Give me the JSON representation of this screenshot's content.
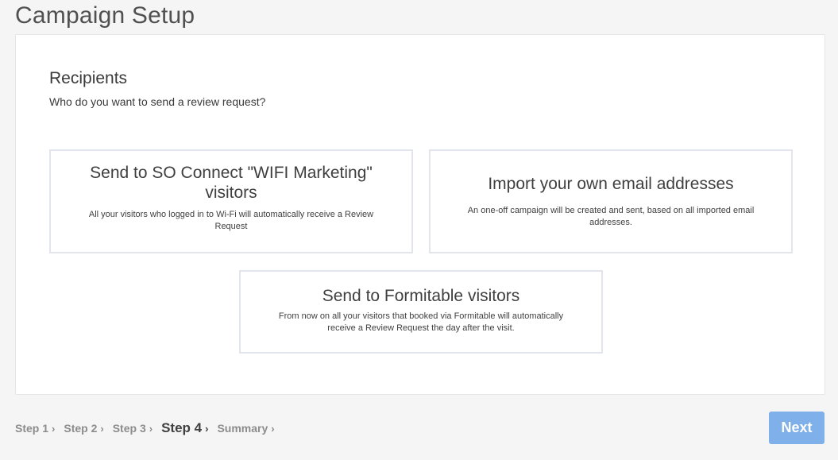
{
  "page": {
    "title": "Campaign Setup"
  },
  "recipients": {
    "title": "Recipients",
    "subtitle": "Who do you want to send a review request?",
    "options": [
      {
        "title": "Send to SO Connect \"WIFI Marketing\" visitors",
        "description": "All your visitors who logged in to Wi-Fi will automatically receive a Review Request"
      },
      {
        "title": "Import your own email addresses",
        "description": "An one-off campaign will be created and sent, based on all imported email addresses."
      },
      {
        "title": "Send to Formitable visitors",
        "description": "From now on all your visitors that booked via Formitable will automatically receive a Review Request the day after the visit."
      }
    ]
  },
  "steps": [
    {
      "label": "Step 1",
      "active": false
    },
    {
      "label": "Step 2",
      "active": false
    },
    {
      "label": "Step 3",
      "active": false
    },
    {
      "label": "Step 4",
      "active": true
    },
    {
      "label": "Summary",
      "active": false
    }
  ],
  "chevron_glyph": "›",
  "next_button": {
    "label": "Next",
    "color": "#7fb0e9"
  }
}
